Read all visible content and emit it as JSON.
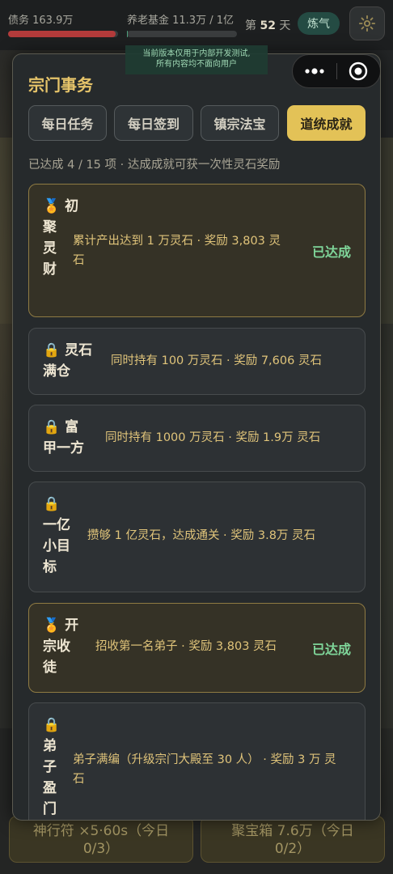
{
  "topbar": {
    "debt_label": "债务 163.9万",
    "debt_progress": 0.98,
    "fund_label": "养老基金 11.3万 / 1亿",
    "fund_progress": 0.001,
    "day_prefix": "第",
    "day_value": "52",
    "day_suffix": "天",
    "refine_label": "炼气",
    "settings_icon": "gear-icon"
  },
  "test_note": {
    "line1": "当前版本仅用于内部开发测试,",
    "line2": "所有内容均不面向用户"
  },
  "modal": {
    "title": "宗门事务",
    "capsule": {
      "more_icon": "more-dots-icon",
      "close_icon": "target-close-icon"
    },
    "tabs": [
      {
        "label": "每日任务",
        "active": false
      },
      {
        "label": "每日签到",
        "active": false
      },
      {
        "label": "镇宗法宝",
        "active": false
      },
      {
        "label": "道统成就",
        "active": true
      }
    ],
    "summary": "已达成 4 / 15 项 · 达成成就可获一次性灵石奖励",
    "achievements": [
      {
        "icon": "🏅",
        "name_lines": [
          "初",
          "聚",
          "灵",
          "财"
        ],
        "desc": "累计产出达到 1 万灵石 · 奖励 3,803 灵石",
        "status": "已达成",
        "done": true
      },
      {
        "icon": "🔒",
        "name_lines": [
          "灵石",
          "满仓"
        ],
        "desc": "同时持有 100 万灵石 · 奖励 7,606 灵石",
        "status": "",
        "done": false
      },
      {
        "icon": "🔒",
        "name_lines": [
          "富",
          "甲一方"
        ],
        "desc": "同时持有 1000 万灵石 · 奖励 1.9万 灵石",
        "status": "",
        "done": false
      },
      {
        "icon": "🔒",
        "name_lines": [
          "",
          "一亿",
          "小目",
          "标"
        ],
        "desc": "攒够 1 亿灵石，达成通关 · 奖励 3.8万 灵石",
        "status": "",
        "done": false
      },
      {
        "icon": "🏅",
        "name_lines": [
          "开",
          "宗收",
          "徒"
        ],
        "desc": "招收第一名弟子 · 奖励 3,803 灵石",
        "status": "已达成",
        "done": true
      },
      {
        "icon": "🔒",
        "name_lines": [
          "",
          "弟",
          "子",
          "盈",
          "门"
        ],
        "desc": "弟子满编（升级宗门大殿至 30 人） · 奖励 3 万 灵石",
        "status": "",
        "done": false
      }
    ]
  },
  "bottom": {
    "left_line1": "神行符 ×5·60s（今日",
    "left_line2": "0/3）",
    "right_line1": "聚宝箱 7.6万（今日",
    "right_line2": "0/2）"
  }
}
